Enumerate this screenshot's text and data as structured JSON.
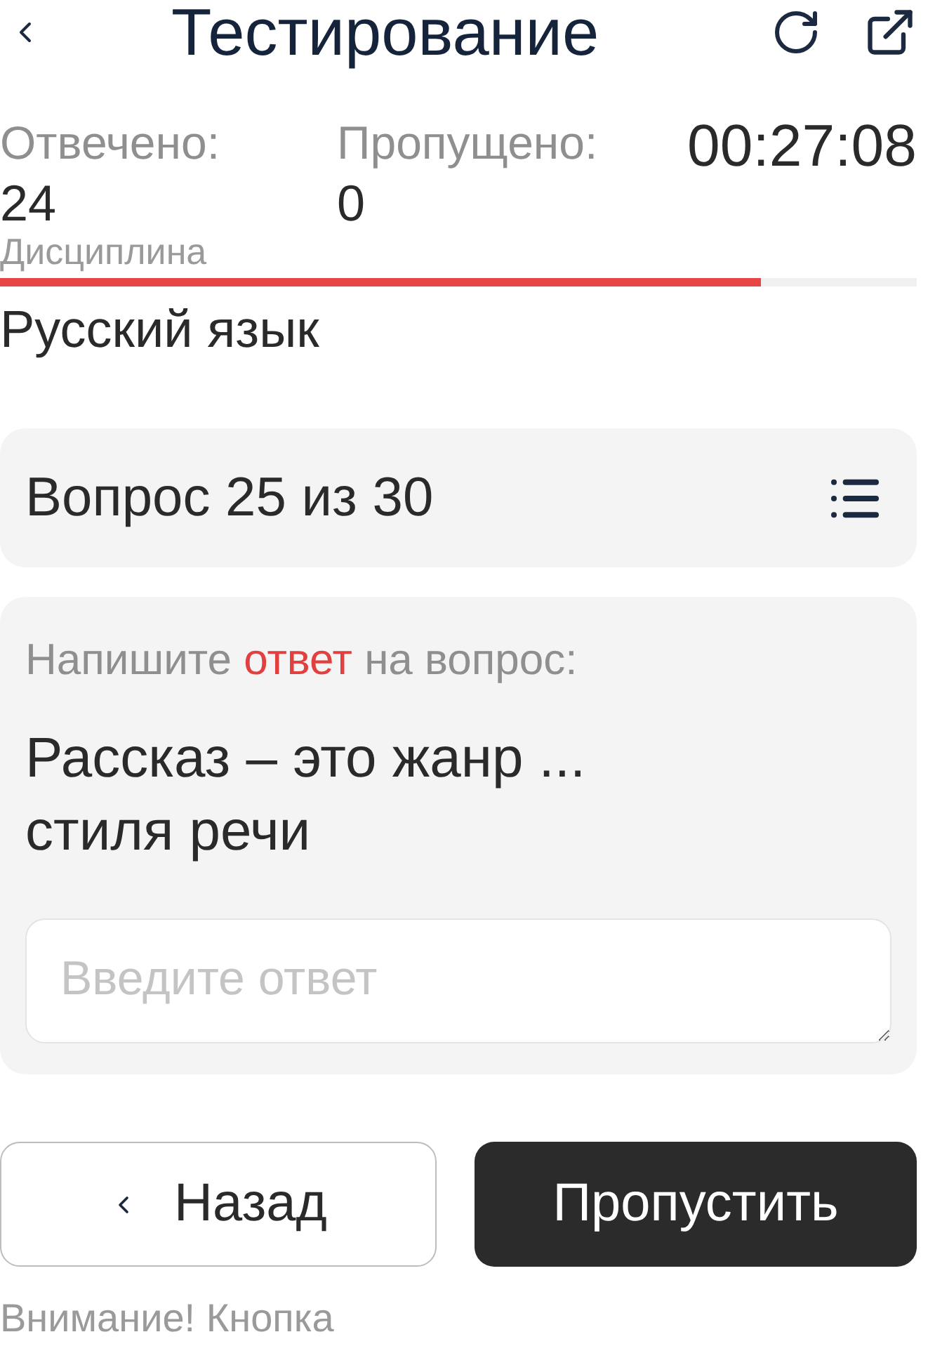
{
  "header": {
    "title": "Тестирование"
  },
  "stats": [
    {
      "label": "Отвечено:",
      "value": "24"
    },
    {
      "label": "Пропущено:",
      "value": "0"
    }
  ],
  "timer": "00:27:08",
  "discipline": {
    "label": "Дисциплина",
    "value": "Русский язык"
  },
  "progress": {
    "level": 0.83
  },
  "question_header": {
    "title": "Вопрос 25 из 30"
  },
  "question": {
    "prompt": {
      "before": "Напишите",
      "highlight": "ответ",
      "after": "на вопрос:"
    },
    "text": "Рассказ – это жанр ... стиля речи",
    "answer": {
      "placeholder": "Введите ответ"
    }
  },
  "buttons": [
    {
      "kind": "back",
      "label": "Назад"
    },
    {
      "kind": "skip",
      "label": "Пропустить"
    }
  ],
  "notice": "Внимание! Кнопка"
}
